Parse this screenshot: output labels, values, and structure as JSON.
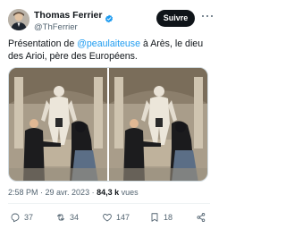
{
  "author": {
    "name": "Thomas Ferrier",
    "handle": "@ThFerrier",
    "verified": true
  },
  "follow_label": "Suivre",
  "tweet": {
    "text_before": "Présentation de ",
    "mention": "@peaulaiteuse",
    "text_after": " à Arès, le dieu des Arioi, père des Européens."
  },
  "media": {
    "photo_count": 2,
    "icon": "photo-icon"
  },
  "meta": {
    "time": "2:58 PM",
    "separator1": " · ",
    "date": "29 avr. 2023",
    "separator2": " · ",
    "views_count": "84,3 k",
    "views_label": " vues"
  },
  "actions": {
    "replies": "37",
    "retweets": "34",
    "likes": "147",
    "bookmarks": "18"
  },
  "colors": {
    "accent": "#1d9bf0",
    "text": "#0f1419",
    "muted": "#536471",
    "button_bg": "#0f1419"
  }
}
